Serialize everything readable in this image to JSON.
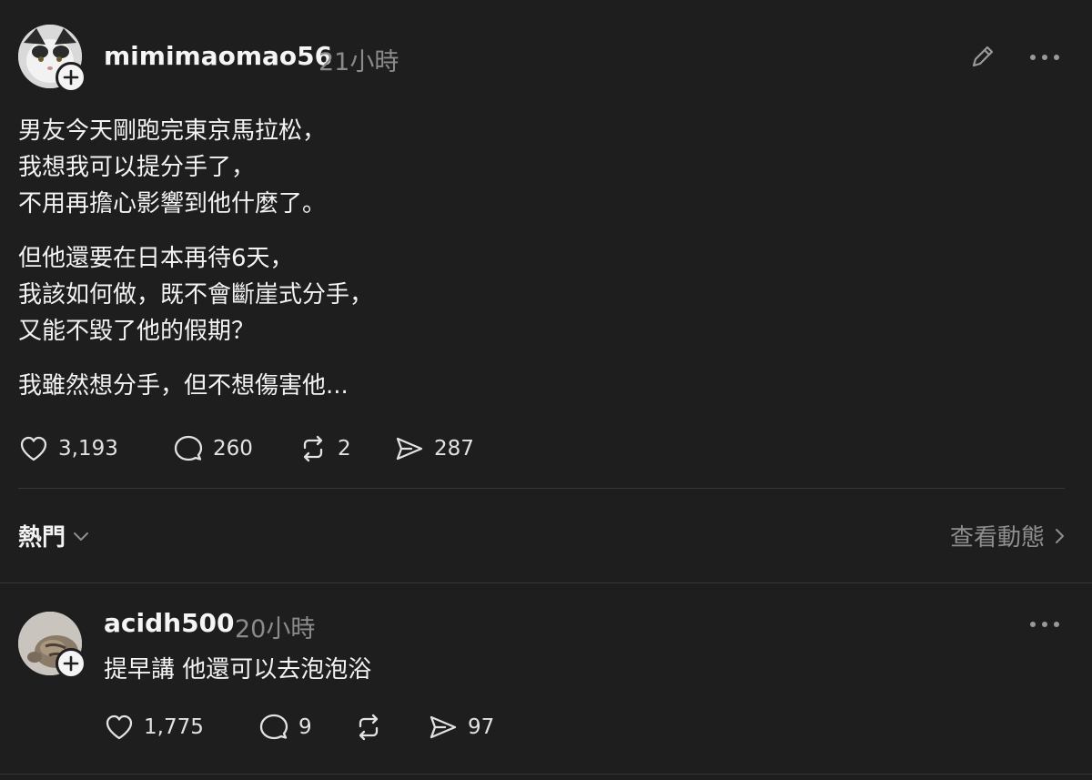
{
  "post": {
    "username": "mimimaomao56",
    "time": "21小時",
    "paragraphs": [
      "男友今天剛跑完東京馬拉松，\n我想我可以提分手了，\n不用再擔心影響到他什麼了。",
      "但他還要在日本再待6天，\n我該如何做，既不會斷崖式分手，\n又能不毀了他的假期？",
      "我雖然想分手，但不想傷害他..."
    ],
    "likes": "3,193",
    "comments": "260",
    "reposts": "2",
    "shares": "287"
  },
  "replies_header": {
    "sort_label": "熱門",
    "activity_label": "查看動態"
  },
  "reply": {
    "username": "acidh500",
    "time": "20小時",
    "text": "提早講 他還可以去泡泡浴",
    "likes": "1,775",
    "comments": "9",
    "shares": "97"
  },
  "icons": [
    "heart-icon",
    "comment-icon",
    "repost-icon",
    "share-icon",
    "edit-icon",
    "more-icon",
    "plus-icon",
    "chevron-down-icon",
    "chevron-right-icon"
  ]
}
